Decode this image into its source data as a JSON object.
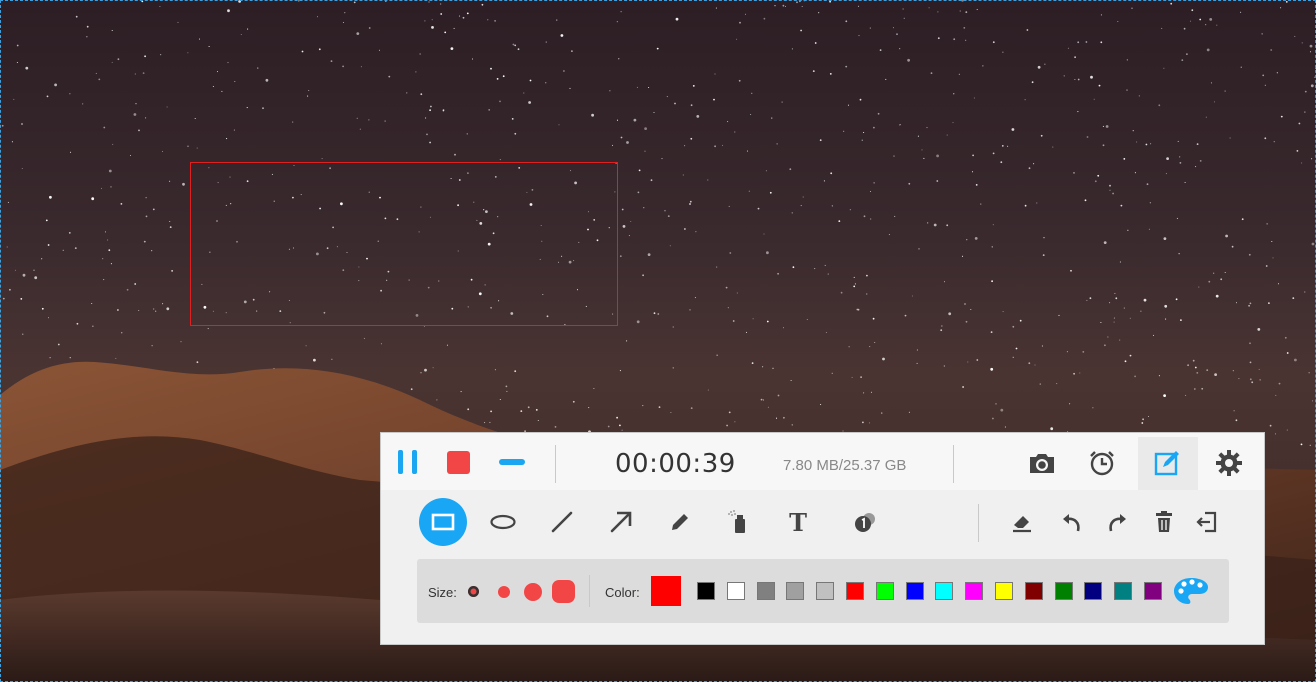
{
  "recorder": {
    "timer": "00:00:39",
    "storage": "7.80 MB/25.37 GB"
  },
  "options": {
    "size_label": "Size:",
    "color_label": "Color:",
    "current_color": "#ff0000",
    "swatches": [
      "#000000",
      "#ffffff",
      "#808080",
      "#a0a0a0",
      "#c0c0c0",
      "#ff0000",
      "#00ff00",
      "#0000ff",
      "#00ffff",
      "#ff00ff",
      "#ffff00",
      "#800000",
      "#008000",
      "#000080",
      "#008080",
      "#800080"
    ]
  },
  "colors": {
    "accent": "#19a7f5",
    "stop": "#f24646",
    "selection": "#e02020"
  },
  "icons": {
    "top": [
      "pause-icon",
      "stop-icon",
      "minimize-icon",
      "camera-icon",
      "alarm-clock-icon",
      "edit-icon",
      "gear-icon"
    ],
    "tools": [
      "rectangle-icon",
      "ellipse-icon",
      "line-icon",
      "arrow-icon",
      "pencil-icon",
      "spray-icon",
      "text-icon",
      "number-step-icon",
      "eraser-icon",
      "undo-icon",
      "redo-icon",
      "trash-icon",
      "exit-icon"
    ]
  }
}
